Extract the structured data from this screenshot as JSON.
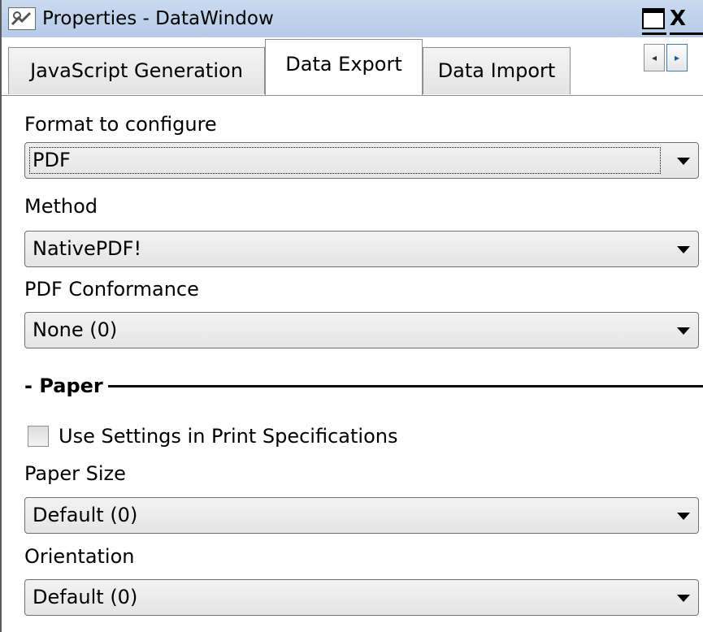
{
  "window": {
    "title": "Properties - DataWindow",
    "icon": "properties-icon",
    "maximize_icon": "maximize-icon",
    "close_icon": "close-icon",
    "close_glyph": "X"
  },
  "tabs": [
    {
      "label": "JavaScript Generation",
      "active": false
    },
    {
      "label": "Data Export",
      "active": true
    },
    {
      "label": "Data Import",
      "active": false
    }
  ],
  "tab_scroll": {
    "left_glyph": "◂",
    "right_glyph": "▸"
  },
  "form": {
    "format": {
      "label": "Format to configure",
      "value": "PDF"
    },
    "method": {
      "label": "Method",
      "value": "NativePDF!"
    },
    "conformance": {
      "label": "PDF Conformance",
      "value": "None (0)"
    },
    "paper_group": {
      "title": "- Paper"
    },
    "use_print_settings": {
      "label": "Use Settings in Print Specifications",
      "checked": false
    },
    "paper_size": {
      "label": "Paper Size",
      "value": "Default (0)"
    },
    "orientation": {
      "label": "Orientation",
      "value": "Default (0)"
    }
  }
}
